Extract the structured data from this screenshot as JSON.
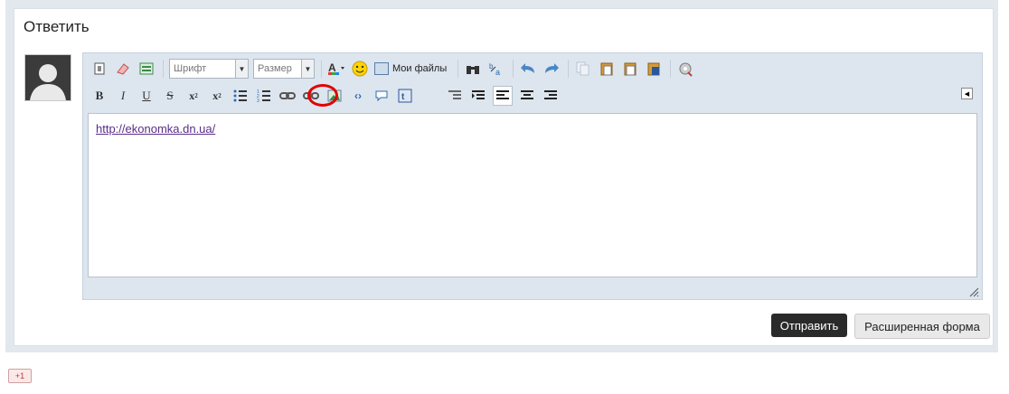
{
  "form": {
    "title": "Ответить"
  },
  "toolbar": {
    "font_label": "Шрифт",
    "size_label": "Размер",
    "files_label": "Мои файлы"
  },
  "editor": {
    "link_text": "http://ekonomka.dn.ua/"
  },
  "actions": {
    "send_label": "Отправить",
    "extended_label": "Расширенная форма"
  },
  "social": {
    "gplus_label": "+1"
  },
  "colors": {
    "send_bg": "#2a2a2a",
    "link": "#5a2c8a",
    "highlight_circle": "#e30000"
  }
}
